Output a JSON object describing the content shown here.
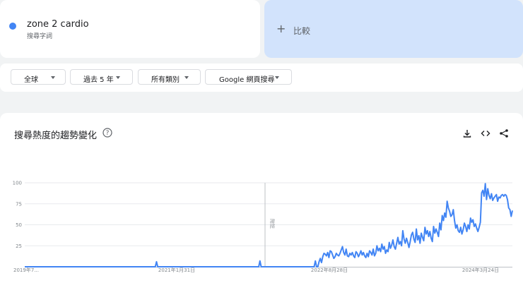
{
  "search_term": {
    "label": "zone 2 cardio",
    "type": "搜尋字詞",
    "dot_color": "#4285f4"
  },
  "compare": {
    "plus": "+",
    "label": "比較"
  },
  "filters": [
    {
      "label": "全球"
    },
    {
      "label": "過去 5 年"
    },
    {
      "label": "所有類別"
    },
    {
      "label": "Google 網頁搜尋"
    }
  ],
  "chart_section": {
    "title": "搜尋熱度的趨勢變化",
    "help_icon": "help-icon",
    "download_icon": "download-icon",
    "embed_icon": "embed-icon",
    "share_icon": "share-icon"
  },
  "chart_data": {
    "type": "line",
    "ylim": [
      0,
      100
    ],
    "y_ticks": [
      "100",
      "75",
      "50",
      "25"
    ],
    "x_tick_labels": [
      "2019年7...",
      "2021年1月31日",
      "2022年8月28日",
      "2024年3月24日"
    ],
    "annotation": "附註",
    "line_color": "#4285f4",
    "grid": true,
    "series": [
      {
        "values": [
          0,
          0,
          0,
          0,
          0,
          0,
          0,
          0,
          0,
          0,
          0,
          0,
          0,
          0,
          0,
          0,
          0,
          0,
          0,
          0,
          0,
          0,
          0,
          0,
          0,
          0,
          0,
          0,
          0,
          0,
          0,
          0,
          0,
          0,
          0,
          0,
          0,
          0,
          0,
          0,
          0,
          0,
          0,
          0,
          0,
          0,
          0,
          0,
          0,
          0,
          0,
          0,
          0,
          0,
          0,
          0,
          0,
          0,
          0,
          0,
          0,
          0,
          0,
          0,
          0,
          0,
          0,
          0,
          0,
          0,
          0,
          0,
          0,
          0,
          0,
          0,
          0,
          0,
          0,
          0,
          0,
          0,
          0,
          0,
          0,
          0,
          0,
          0,
          0,
          0,
          0,
          0,
          0,
          0,
          0,
          0,
          0,
          0,
          0,
          0,
          0,
          0,
          0,
          0,
          0,
          0,
          0,
          6,
          0,
          0,
          0,
          0,
          0,
          0,
          0,
          0,
          0,
          0,
          0,
          0,
          0,
          0,
          0,
          0,
          0,
          0,
          0,
          0,
          0,
          0,
          0,
          0,
          0,
          0,
          0,
          0,
          0,
          0,
          0,
          0,
          0,
          0,
          0,
          0,
          0,
          0,
          0,
          0,
          0,
          0,
          0,
          0,
          0,
          0,
          0,
          0,
          0,
          0,
          0,
          0,
          0,
          0,
          0,
          0,
          0,
          0,
          0,
          0,
          0,
          0,
          0,
          0,
          0,
          0,
          0,
          0,
          0,
          0,
          0,
          0,
          0,
          0,
          0,
          0,
          0,
          0,
          0,
          0,
          0,
          0,
          0,
          7,
          0,
          0,
          0,
          0,
          0,
          0,
          0,
          0,
          0,
          0,
          0,
          0,
          0,
          0,
          0,
          0,
          0,
          0,
          0,
          0,
          0,
          0,
          0,
          0,
          0,
          0,
          0,
          0,
          0,
          0,
          0,
          0,
          0,
          0,
          0,
          0,
          0,
          0,
          0,
          0,
          0,
          0,
          0,
          0,
          7,
          0,
          0,
          6,
          10,
          5,
          12,
          16,
          15,
          13,
          17,
          11,
          19,
          18,
          14,
          10,
          12,
          16,
          14,
          13,
          16,
          20,
          24,
          17,
          14,
          21,
          13,
          12,
          16,
          14,
          17,
          13,
          11,
          18,
          16,
          12,
          15,
          19,
          14,
          17,
          13,
          11,
          16,
          12,
          19,
          17,
          14,
          21,
          13,
          16,
          25,
          19,
          22,
          18,
          27,
          21,
          24,
          16,
          20,
          18,
          29,
          22,
          26,
          32,
          24,
          21,
          28,
          35,
          27,
          30,
          25,
          43,
          33,
          28,
          34,
          29,
          23,
          30,
          38,
          41,
          33,
          29,
          45,
          32,
          37,
          28,
          40,
          35,
          31,
          47,
          39,
          43,
          36,
          42,
          34,
          30,
          48,
          40,
          45,
          41,
          36,
          52,
          44,
          61,
          55,
          64,
          59,
          78,
          70,
          66,
          60,
          62,
          68,
          55,
          46,
          50,
          43,
          41,
          47,
          39,
          44,
          52,
          48,
          42,
          50,
          45,
          58,
          53,
          56,
          48,
          51,
          46,
          42,
          47,
          53,
          88,
          91,
          84,
          99,
          80,
          93,
          85,
          81,
          87,
          79,
          82,
          84,
          86,
          78,
          83,
          82,
          85,
          86,
          84,
          86,
          85,
          80,
          70,
          68,
          60,
          67
        ]
      }
    ]
  }
}
